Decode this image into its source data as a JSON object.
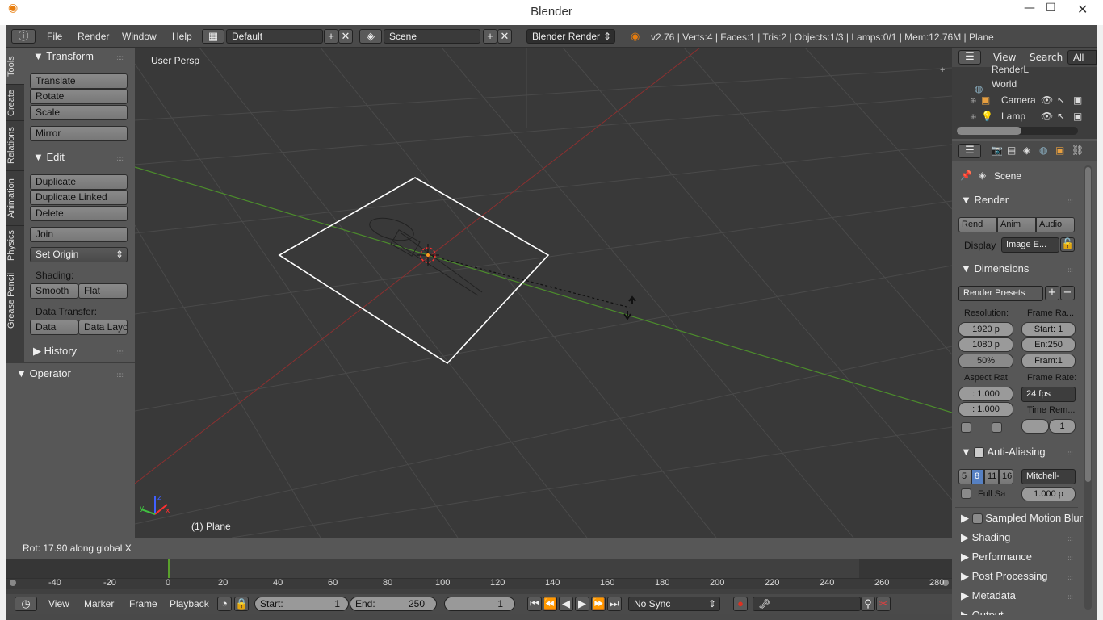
{
  "window": {
    "title": "Blender"
  },
  "menubar": {
    "items": [
      "File",
      "Render",
      "Window",
      "Help"
    ],
    "layout": "Default",
    "scene": "Scene",
    "engine": "Blender Render",
    "stats": "v2.76 | Verts:4 | Faces:1 | Tris:2 | Objects:1/3 | Lamps:0/1 | Mem:12.76M | Plane"
  },
  "toolshelf": {
    "tabs": [
      "Tools",
      "Create",
      "Relations",
      "Animation",
      "Physics",
      "Grease Pencil"
    ],
    "transform": {
      "title": "Transform",
      "buttons": [
        "Translate",
        "Rotate",
        "Scale",
        "Mirror"
      ]
    },
    "edit": {
      "title": "Edit",
      "buttons": [
        "Duplicate",
        "Duplicate Linked",
        "Delete",
        "Join"
      ],
      "set_origin": "Set Origin",
      "shading_label": "Shading:",
      "smooth": "Smooth",
      "flat": "Flat",
      "data_transfer_label": "Data Transfer:",
      "data": "Data",
      "data_layout": "Data Layo"
    },
    "history": "History",
    "operator": "Operator"
  },
  "viewport": {
    "view_label": "User Persp",
    "object_label": "(1) Plane"
  },
  "status": {
    "text": "Rot: 17.90 along global X"
  },
  "timeline": {
    "ticks": [
      "-40",
      "-20",
      "0",
      "20",
      "40",
      "60",
      "80",
      "100",
      "120",
      "140",
      "160",
      "180",
      "200",
      "220",
      "240",
      "260",
      "280"
    ],
    "menu": [
      "View",
      "Marker",
      "Frame",
      "Playback"
    ],
    "start_label": "Start:",
    "start": "1",
    "end_label": "End:",
    "end": "250",
    "current": "1",
    "sync": "No Sync"
  },
  "outliner": {
    "menu": [
      "View",
      "Search"
    ],
    "filter": "All Sc",
    "items": [
      "RenderL",
      "World",
      "Camera",
      "Lamp"
    ]
  },
  "properties": {
    "scene": "Scene",
    "render": {
      "title": "Render",
      "buttons": [
        "Rend",
        "Anim",
        "Audio"
      ],
      "display_label": "Display",
      "display_value": "Image E..."
    },
    "dimensions": {
      "title": "Dimensions",
      "presets": "Render Presets",
      "resolution_label": "Resolution:",
      "res_x": "1920 p",
      "res_y": "1080 p",
      "res_pct": "50%",
      "frame_range_label": "Frame Ra...",
      "start": "Start: 1",
      "end": "En:250",
      "step": "Fram:1",
      "aspect_label": "Aspect Rat",
      "aspect_x": ": 1.000",
      "aspect_y": ": 1.000",
      "frame_rate_label": "Frame Rate:",
      "fps": "24 fps",
      "time_remap_label": "Time Rem...",
      "time_remap_value": "1"
    },
    "anti_aliasing": {
      "title": "Anti-Aliasing",
      "samples": [
        "5",
        "8",
        "11",
        "16"
      ],
      "filter": "Mitchell-",
      "full_sample": "Full Sa",
      "size": "1.000 p"
    },
    "collapsed": [
      "Sampled Motion Blur",
      "Shading",
      "Performance",
      "Post Processing",
      "Metadata",
      "Output"
    ]
  }
}
